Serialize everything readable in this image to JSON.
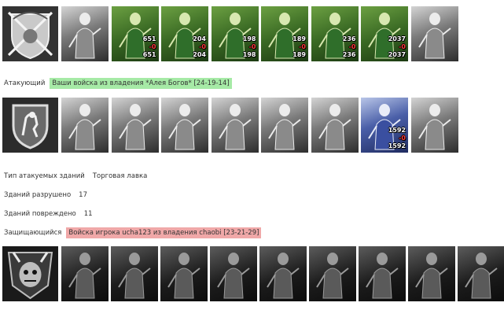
{
  "attacker": {
    "label": "Атакующий",
    "value": "Ваши войска из владения *Алея Богов* [24-19-14]",
    "units": [
      {
        "icon": "dwarf-figure-icon",
        "style": "gray"
      },
      {
        "icon": "elf-swordsman-icon",
        "style": "green",
        "count": "651",
        "loss": "-0",
        "remain": "651"
      },
      {
        "icon": "elf-spearman-icon",
        "style": "green",
        "count": "204",
        "loss": "-0",
        "remain": "204"
      },
      {
        "icon": "pegasus-icon",
        "style": "green",
        "count": "198",
        "loss": "-0",
        "remain": "198"
      },
      {
        "icon": "elf-archer-icon",
        "style": "green",
        "count": "189",
        "loss": "-0",
        "remain": "189"
      },
      {
        "icon": "druid-icon",
        "style": "green",
        "count": "236",
        "loss": "-0",
        "remain": "236"
      },
      {
        "icon": "elf-sorcerer-icon",
        "style": "green",
        "count": "2037",
        "loss": "-0",
        "remain": "2037"
      },
      {
        "icon": "cloaked-figure-icon",
        "style": "gray"
      }
    ]
  },
  "middle_units": [
    {
      "icon": "knight-figure-icon",
      "style": "gray"
    },
    {
      "icon": "pikeman-icon",
      "style": "gray"
    },
    {
      "icon": "cavalry-icon",
      "style": "gray"
    },
    {
      "icon": "griffin-icon",
      "style": "gray"
    },
    {
      "icon": "crossbowman-icon",
      "style": "gray"
    },
    {
      "icon": "monk-icon",
      "style": "gray"
    },
    {
      "icon": "paladin-icon",
      "style": "blue",
      "count": "1592",
      "loss": "-0",
      "remain": "1592"
    },
    {
      "icon": "angel-icon",
      "style": "gray"
    }
  ],
  "info": {
    "target_label": "Тип атакуемых зданий",
    "target_value": "Торговая лавка",
    "destroyed_label": "Зданий разрушено",
    "destroyed_value": "17",
    "damaged_label": "Зданий повреждено",
    "damaged_value": "11"
  },
  "defender": {
    "label": "Защищающийся",
    "value": "Войска игрока ucha123 из владения chaobi [23-21-29]",
    "units": [
      {
        "icon": "demon-hound-icon",
        "style": "dark"
      },
      {
        "icon": "skeleton-icon",
        "style": "dark"
      },
      {
        "icon": "beast-icon",
        "style": "dark"
      },
      {
        "icon": "wraith-icon",
        "style": "dark"
      },
      {
        "icon": "werewolf-icon",
        "style": "dark"
      },
      {
        "icon": "lich-icon",
        "style": "dark"
      },
      {
        "icon": "death-knight-icon",
        "style": "dark"
      },
      {
        "icon": "dread-lord-icon",
        "style": "dark"
      },
      {
        "icon": "reaper-icon",
        "style": "dark"
      }
    ]
  }
}
